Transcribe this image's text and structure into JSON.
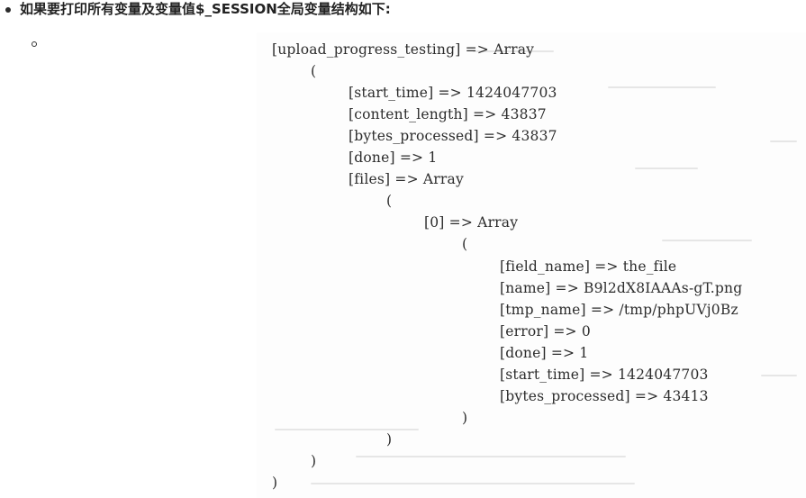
{
  "heading": {
    "text": "如果要打印所有变量及变量值$_SESSION全局变量结构如下:"
  },
  "code": {
    "lines": [
      {
        "text": "[upload_progress_testing] => Array",
        "indent": 0
      },
      {
        "text": "(",
        "indent": 1
      },
      {
        "text": "[start_time] => 1424047703",
        "indent": 2
      },
      {
        "text": "[content_length] => 43837",
        "indent": 2
      },
      {
        "text": "[bytes_processed] => 43837",
        "indent": 2
      },
      {
        "text": "[done] => 1",
        "indent": 2
      },
      {
        "text": "[files] => Array",
        "indent": 2
      },
      {
        "text": "(",
        "indent": 3
      },
      {
        "text": "[0] => Array",
        "indent": 4
      },
      {
        "text": "(",
        "indent": 5
      },
      {
        "text": "[field_name] => the_file",
        "indent": 6
      },
      {
        "text": "[name] => B9l2dX8IAAAs-gT.png",
        "indent": 6
      },
      {
        "text": "[tmp_name] => /tmp/phpUVj0Bz",
        "indent": 6
      },
      {
        "text": "[error] => 0",
        "indent": 6
      },
      {
        "text": "[done] => 1",
        "indent": 6
      },
      {
        "text": "[start_time] => 1424047703",
        "indent": 6
      },
      {
        "text": "[bytes_processed] => 43413",
        "indent": 6
      },
      {
        "text": ")",
        "indent": 5
      },
      {
        "text": ")",
        "indent": 3
      },
      {
        "text": ")",
        "indent": 1
      },
      {
        "text": ")",
        "indent": 0
      }
    ]
  }
}
